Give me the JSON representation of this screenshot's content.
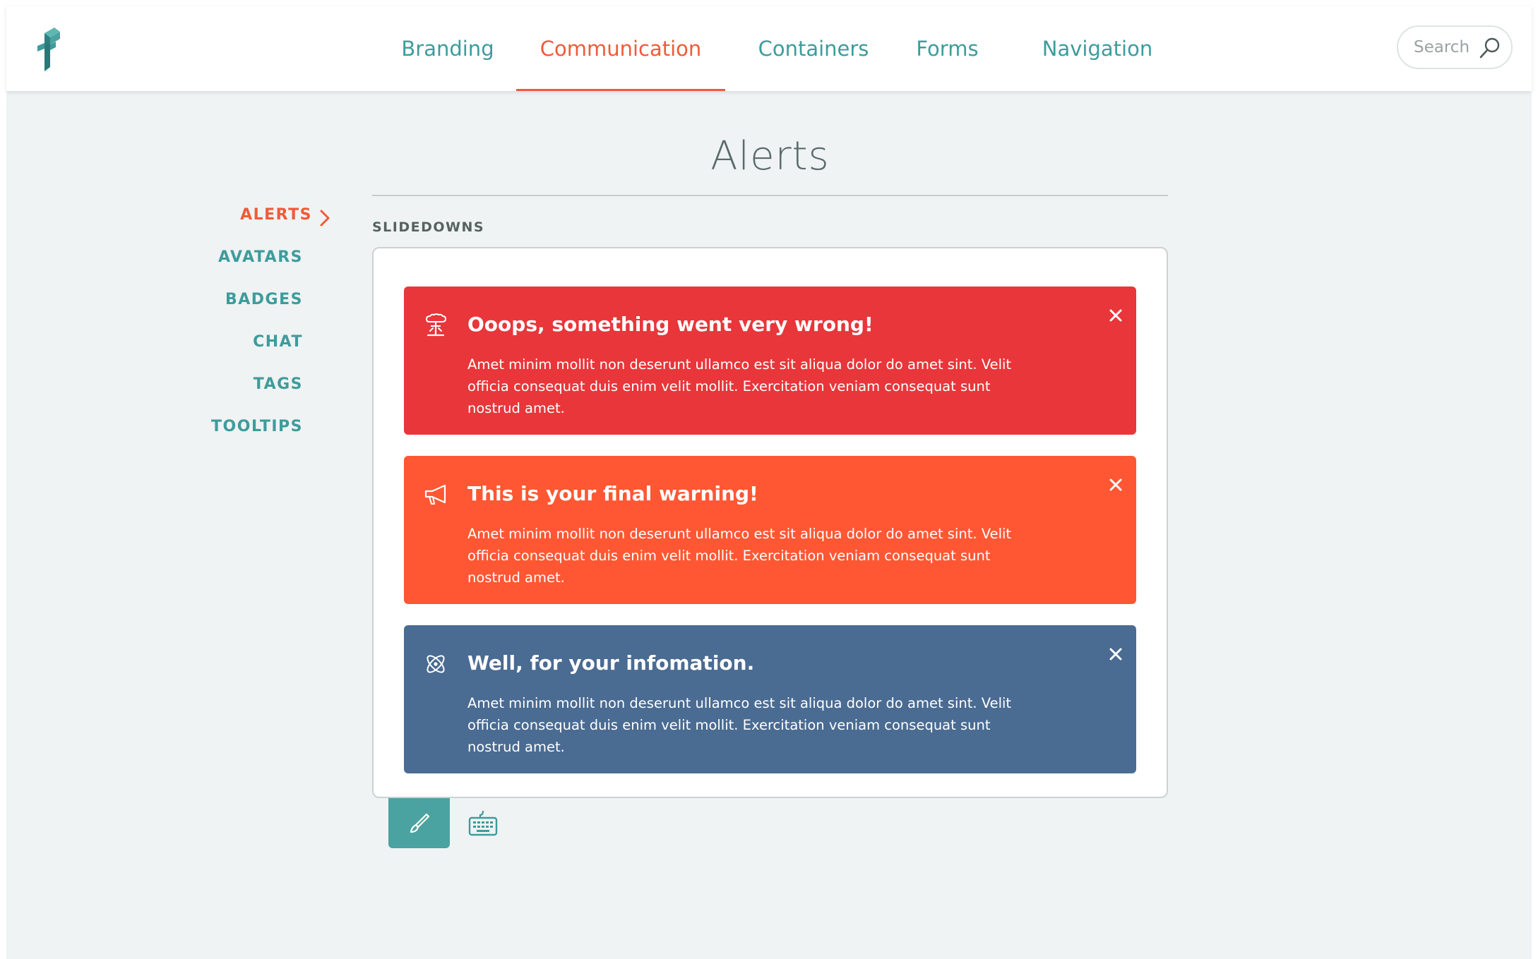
{
  "nav": {
    "items": [
      {
        "label": "Branding",
        "active": false
      },
      {
        "label": "Communication",
        "active": true
      },
      {
        "label": "Containers",
        "active": false
      },
      {
        "label": "Forms",
        "active": false
      },
      {
        "label": "Navigation",
        "active": false
      }
    ]
  },
  "search": {
    "placeholder": "Search",
    "icon": "search-icon"
  },
  "page": {
    "title": "Alerts",
    "section_label": "SLIDEDOWNS"
  },
  "sidebar": {
    "items": [
      {
        "label": "ALERTS",
        "active": true
      },
      {
        "label": "AVATARS",
        "active": false
      },
      {
        "label": "BADGES",
        "active": false
      },
      {
        "label": "CHAT",
        "active": false
      },
      {
        "label": "TAGS",
        "active": false
      },
      {
        "label": "TOOLTIPS",
        "active": false
      }
    ]
  },
  "alerts": [
    {
      "variant": "error",
      "color": "#e8363a",
      "icon": "explosion-icon",
      "title": "Ooops, something went very wrong!",
      "body": "Amet minim mollit non deserunt ullamco est sit aliqua dolor do amet sint. Velit officia consequat duis enim velit mollit. Exercitation veniam consequat sunt nostrud amet."
    },
    {
      "variant": "warning",
      "color": "#ff5733",
      "icon": "megaphone-icon",
      "title": "This is your final warning!",
      "body": "Amet minim mollit non deserunt ullamco est sit aliqua dolor do amet sint. Velit officia consequat duis enim velit mollit. Exercitation veniam consequat sunt nostrud amet."
    },
    {
      "variant": "info",
      "color": "#4a6b92",
      "icon": "atom-icon",
      "title": "Well, for your infomation.",
      "body": "Amet minim mollit non deserunt ullamco est sit aliqua dolor do amet sint. Velit officia consequat duis enim velit mollit. Exercitation veniam consequat sunt nostrud amet."
    }
  ],
  "colors": {
    "accent": "#3d9c9c",
    "active": "#f15a3a",
    "tab_active": "#4aa3a0"
  },
  "tabs": {
    "design_icon": "brush-icon",
    "code_icon": "keyboard-icon"
  }
}
